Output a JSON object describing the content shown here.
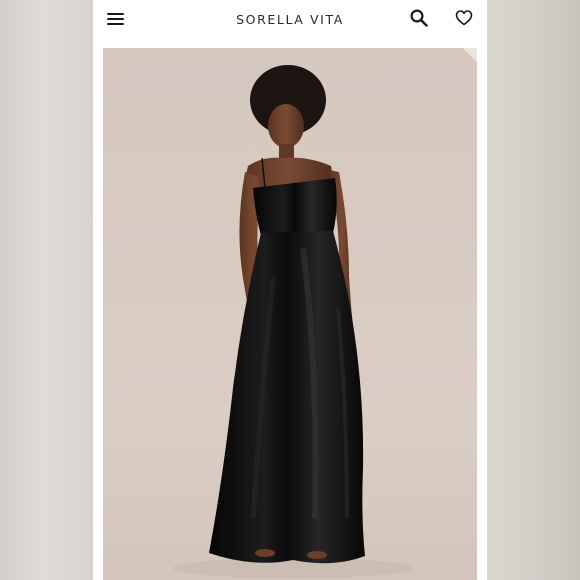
{
  "header": {
    "brand": "SORELLA VITA",
    "menu_icon": "hamburger-menu-icon",
    "search_icon": "search-icon",
    "favorite_icon": "heart-icon"
  },
  "product_image": {
    "subject": "model-in-black-one-shoulder-satin-gown"
  },
  "colors": {
    "header_bg": "#ffffff",
    "photo_bg": "#d8cbc2",
    "dress": "#0d0d0d",
    "text": "#2a2a2a"
  }
}
